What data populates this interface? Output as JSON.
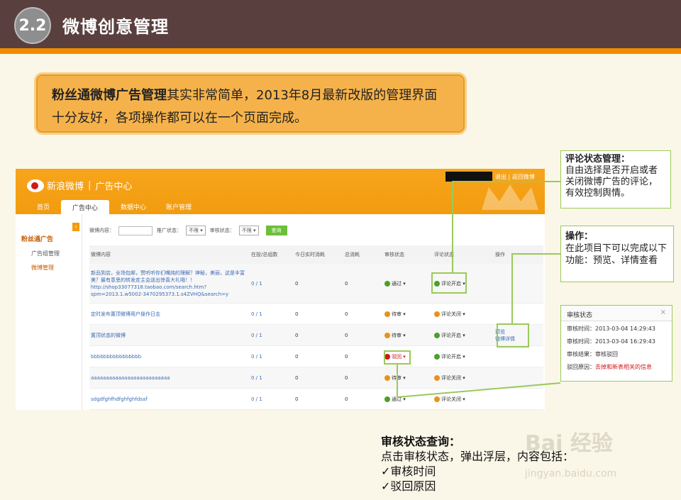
{
  "header": {
    "number": "2.2",
    "title": "微博创意管理"
  },
  "callout": {
    "bold": "粉丝通微博广告管理",
    "rest": "其实非常简单，2013年8月最新改版的管理界面十分友好，各项操作都可以在一个页面完成。"
  },
  "shot": {
    "brand": "新浪微博",
    "brand_sub": "广告中心",
    "logout": "退出 | 返回微博",
    "nav": [
      "首页",
      "广告中心",
      "数据中心",
      "账户管理"
    ],
    "side_title": "粉丝通广告",
    "side_items": [
      "广告组管理",
      "微博管理"
    ],
    "filter": {
      "content_label": "微博内容：",
      "promo_label": "推广状态：",
      "promo_value": "不限 ▾",
      "audit_label": "审核状态：",
      "audit_value": "不限 ▾",
      "query": "查询"
    },
    "columns": [
      "微博内容",
      "在投/总组数",
      "今日实时消耗",
      "总消耗",
      "审核状态",
      "评论状态",
      "操作"
    ],
    "rows": [
      {
        "content": "新品到店，全场包邮，赞听听你们嘴炖的理解？神秘，美丽，这是丰富美？最有意思的转发走主会送出惊喜大礼哦！！ http://shop33077318.taobao.com/search.htm?spm=2013.1.w5002-3470295373.1.s4ZVHQ&search=y",
        "groups": "0 / 1",
        "today": "0",
        "total": "0",
        "audit": "通过",
        "comment": "评论开启",
        "op": ""
      },
      {
        "content": "定时发布置顶微博用户操作日志",
        "groups": "0 / 1",
        "today": "0",
        "total": "0",
        "audit": "待审",
        "comment": "评论关闭",
        "op": ""
      },
      {
        "content": "置顶状态的微博",
        "groups": "0 / 1",
        "today": "0",
        "total": "0",
        "audit": "待审",
        "comment": "评论开启",
        "op": "预览\n微博详情"
      },
      {
        "content": "bbbbbbbbbbbbbbbb",
        "groups": "0 / 1",
        "today": "0",
        "total": "0",
        "audit": "驳回",
        "comment": "评论开启",
        "op": ""
      },
      {
        "content": "aaaaaaaaaaaaaaaaaaaaaaaaaa",
        "groups": "0 / 1",
        "today": "0",
        "total": "0",
        "audit": "待审",
        "comment": "评论关闭",
        "op": ""
      },
      {
        "content": "sdgdfghfhdfghfghfdsaf",
        "groups": "0 / 1",
        "today": "0",
        "total": "0",
        "audit": "通过",
        "comment": "评论关闭",
        "op": ""
      }
    ]
  },
  "note_comment": {
    "title": "评论状态管理：",
    "body": "自由选择是否开启或者关闭微博广告的评论，有效控制舆情。"
  },
  "note_op": {
    "title": "操作：",
    "body": "在此项目下可以完成以下功能：预览、详情查看"
  },
  "popup": {
    "title": "审核状态",
    "close": "×",
    "lines": [
      {
        "label": "审核时间：",
        "value": "2013-03-04 14:29:43"
      },
      {
        "label": "审核时间：",
        "value": "2013-03-04 16:29:43"
      },
      {
        "label": "审核结果：",
        "value": "审核驳回"
      },
      {
        "label": "驳回原因：",
        "value": "去掉和新表相关的信息"
      }
    ]
  },
  "audit_note": {
    "title": "审核状态查询：",
    "line1": "点击审核状态，弹出浮层，内容包括：",
    "item1": "✓审核时间",
    "item2": "✓驳回原因"
  },
  "watermark": {
    "main": "Bai 经验",
    "sub": "jingyan.baidu.com"
  }
}
